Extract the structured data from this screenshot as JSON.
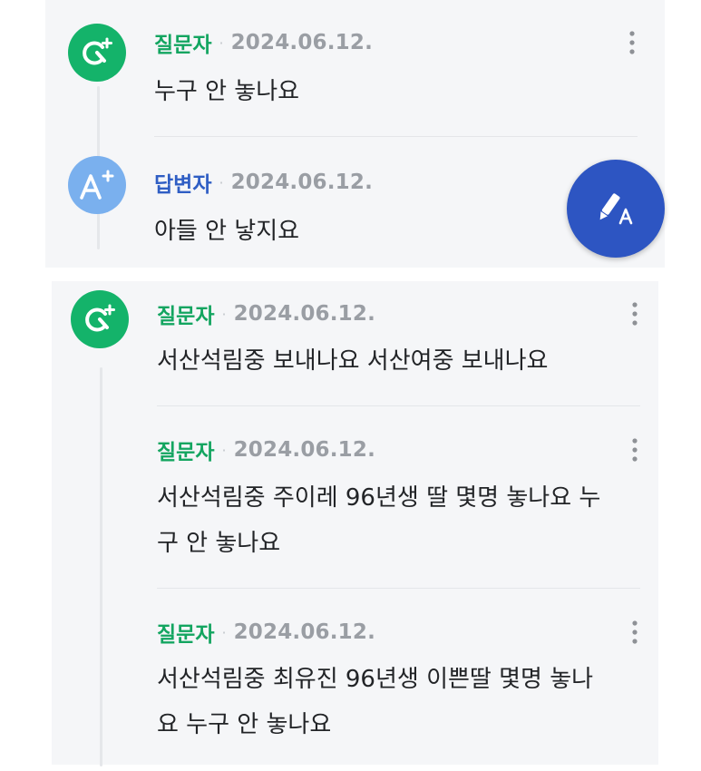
{
  "entries": [
    {
      "role": "질문자",
      "separator": "·",
      "date": "2024.06.12.",
      "text": "누구 안 놓나요"
    },
    {
      "role": "답변자",
      "separator": "·",
      "date": "2024.06.12.",
      "text": "아들 안 낳지요"
    },
    {
      "role": "질문자",
      "separator": "·",
      "date": "2024.06.12.",
      "text": "서산석림중 보내나요 서산여중 보내나요"
    },
    {
      "role": "질문자",
      "separator": "·",
      "date": "2024.06.12.",
      "text_line1": "서산석림중 주이레 96년생 딸 몇명 놓나요 누",
      "text_line2": "구 안 놓나요"
    },
    {
      "role": "질문자",
      "separator": "·",
      "date": "2024.06.12.",
      "text_line1": "서산석림중 최유진 96년생 이쁜딸 몇명 놓나",
      "text_line2": "요 누구 안 놓나요"
    }
  ],
  "icons": {
    "questioner_avatar": "question-badge-icon",
    "answerer_avatar": "answer-badge-icon",
    "more": "more-vertical-icon",
    "fab": "write-answer-icon"
  },
  "colors": {
    "questioner": "#13a560",
    "answerer": "#2f5ec4",
    "fab": "#2d55c2",
    "panel": "#f5f6f8"
  }
}
